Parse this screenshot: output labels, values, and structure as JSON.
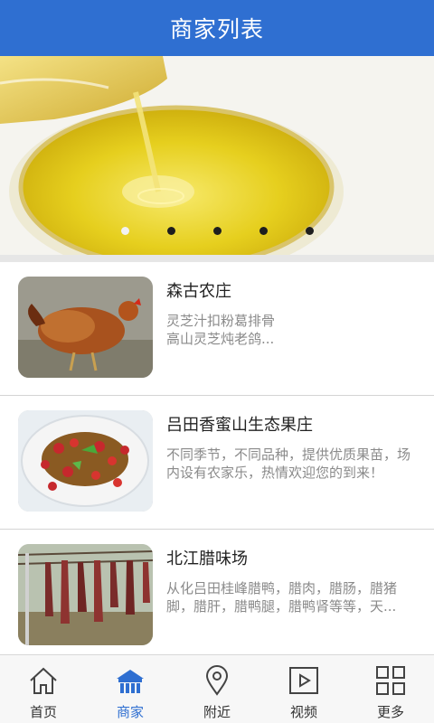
{
  "header": {
    "title": "商家列表"
  },
  "banner": {
    "slide_count": 5,
    "active_index": 0
  },
  "merchants": [
    {
      "name": "森古农庄",
      "desc": "灵芝汁扣粉葛排骨\n高山灵芝炖老鸽..."
    },
    {
      "name": "吕田香蜜山生态果庄",
      "desc": "不同季节，不同品种，提供优质果苗，场内设有农家乐，热情欢迎您的到来！"
    },
    {
      "name": "北江腊味场",
      "desc": "从化吕田桂峰腊鸭，腊肉，腊肠，腊猪脚，腊肝，腊鸭腿，腊鸭肾等等，天..."
    }
  ],
  "tabs": [
    {
      "label": "首页",
      "icon": "home-icon"
    },
    {
      "label": "商家",
      "icon": "store-icon"
    },
    {
      "label": "附近",
      "icon": "location-pin-icon"
    },
    {
      "label": "视频",
      "icon": "video-play-icon"
    },
    {
      "label": "更多",
      "icon": "grid-icon"
    }
  ],
  "colors": {
    "accent": "#2f6fd1",
    "header_bg": "#2f6fd1",
    "tab_inactive": "#333333"
  }
}
